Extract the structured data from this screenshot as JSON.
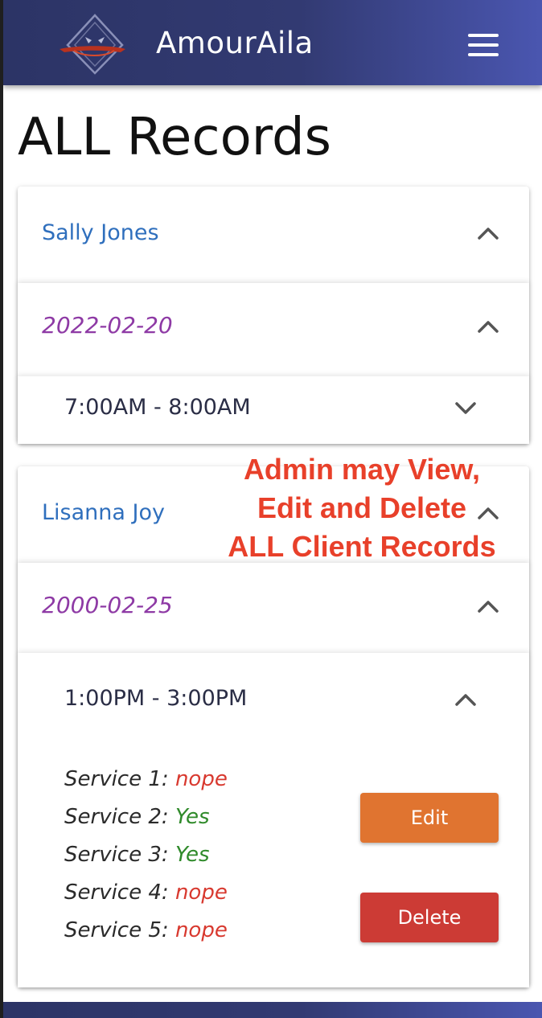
{
  "app": {
    "title": "AmourAila"
  },
  "page": {
    "title": "ALL Records"
  },
  "records": [
    {
      "name": "Sally Jones",
      "date": "2022-02-20",
      "time": "7:00AM - 8:00AM"
    },
    {
      "name": "Lisanna Joy",
      "date": "2000-02-25",
      "time": "1:00PM - 3:00PM",
      "services": [
        {
          "label": "Service 1:",
          "value": "nope"
        },
        {
          "label": "Service 2:",
          "value": "Yes"
        },
        {
          "label": "Service 3:",
          "value": "Yes"
        },
        {
          "label": "Service 4:",
          "value": "nope"
        },
        {
          "label": "Service 5:",
          "value": "nope"
        }
      ],
      "edit_label": "Edit",
      "delete_label": "Delete"
    }
  ],
  "annotation": {
    "line1": "Admin may View,",
    "line2": "Edit and Delete",
    "line3": "ALL Client Records"
  },
  "colors": {
    "appbar": "#323a72",
    "name": "#2f6fbd",
    "date": "#8e3aa5",
    "yes": "#2f8a2a",
    "no": "#d8392f",
    "edit_button": "#e07430",
    "delete_button": "#cc3b35",
    "annotation": "#e8402a"
  },
  "icons": [
    "app-logo-icon",
    "hamburger-menu-icon",
    "chevron-up-icon",
    "chevron-down-icon"
  ]
}
